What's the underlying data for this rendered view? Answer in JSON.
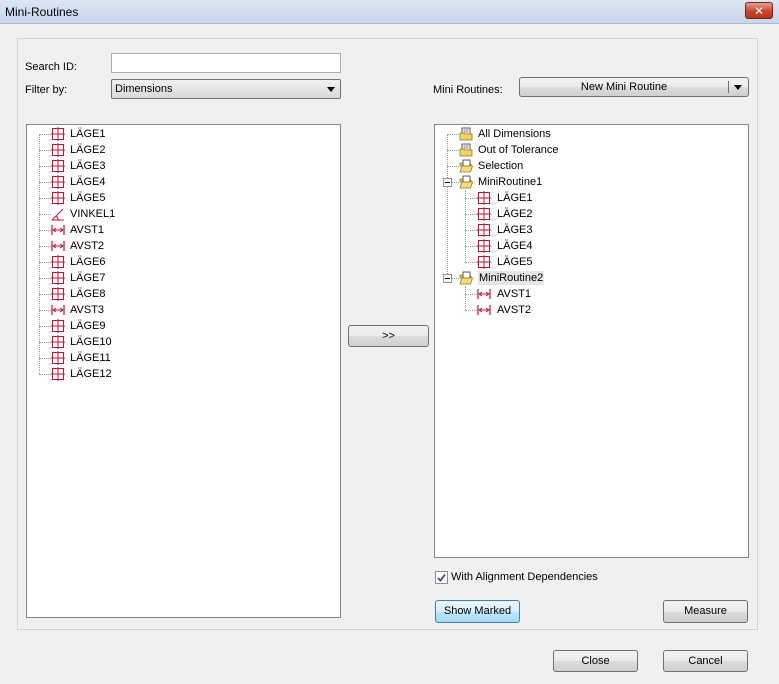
{
  "window": {
    "title": "Mini-Routines",
    "close_label": "✕"
  },
  "search": {
    "label": "Search ID:",
    "value": "",
    "placeholder": ""
  },
  "filter": {
    "label": "Filter by:",
    "selected": "Dimensions"
  },
  "mini_routines": {
    "label": "Mini Routines:",
    "new_button": "New Mini Routine"
  },
  "transfer_button": ">>",
  "left_tree": [
    {
      "label": "LÄGE1",
      "icon": "position-icon"
    },
    {
      "label": "LÄGE2",
      "icon": "position-icon"
    },
    {
      "label": "LÄGE3",
      "icon": "position-icon"
    },
    {
      "label": "LÄGE4",
      "icon": "position-icon"
    },
    {
      "label": "LÄGE5",
      "icon": "position-icon"
    },
    {
      "label": "VINKEL1",
      "icon": "angle-icon"
    },
    {
      "label": "AVST1",
      "icon": "distance-icon"
    },
    {
      "label": "AVST2",
      "icon": "distance-icon"
    },
    {
      "label": "LÄGE6",
      "icon": "position-icon"
    },
    {
      "label": "LÄGE7",
      "icon": "position-icon"
    },
    {
      "label": "LÄGE8",
      "icon": "position-icon"
    },
    {
      "label": "AVST3",
      "icon": "distance-icon"
    },
    {
      "label": "LÄGE9",
      "icon": "position-icon"
    },
    {
      "label": "LÄGE10",
      "icon": "position-icon"
    },
    {
      "label": "LÄGE11",
      "icon": "position-icon"
    },
    {
      "label": "LÄGE12",
      "icon": "position-icon"
    }
  ],
  "right_tree": {
    "top": [
      {
        "label": "All Dimensions",
        "icon": "folder-doc-icon"
      },
      {
        "label": "Out of Tolerance",
        "icon": "folder-doc-icon"
      },
      {
        "label": "Selection",
        "icon": "folder-open-icon"
      }
    ],
    "routines": [
      {
        "label": "MiniRoutine1",
        "children": [
          {
            "label": "LÄGE1",
            "icon": "position-icon"
          },
          {
            "label": "LÄGE2",
            "icon": "position-icon"
          },
          {
            "label": "LÄGE3",
            "icon": "position-icon"
          },
          {
            "label": "LÄGE4",
            "icon": "position-icon"
          },
          {
            "label": "LÄGE5",
            "icon": "position-icon"
          }
        ]
      },
      {
        "label": "MiniRoutine2",
        "selected": true,
        "children": [
          {
            "label": "AVST1",
            "icon": "distance-icon"
          },
          {
            "label": "AVST2",
            "icon": "distance-icon"
          }
        ]
      }
    ]
  },
  "alignment": {
    "label": "With Alignment Dependencies",
    "checked": true
  },
  "buttons": {
    "show_marked": "Show Marked",
    "measure": "Measure",
    "close": "Close",
    "cancel": "Cancel"
  },
  "colors": {
    "dimension_icon": "#c8102e",
    "selection_highlight": "#e6e6e6"
  }
}
